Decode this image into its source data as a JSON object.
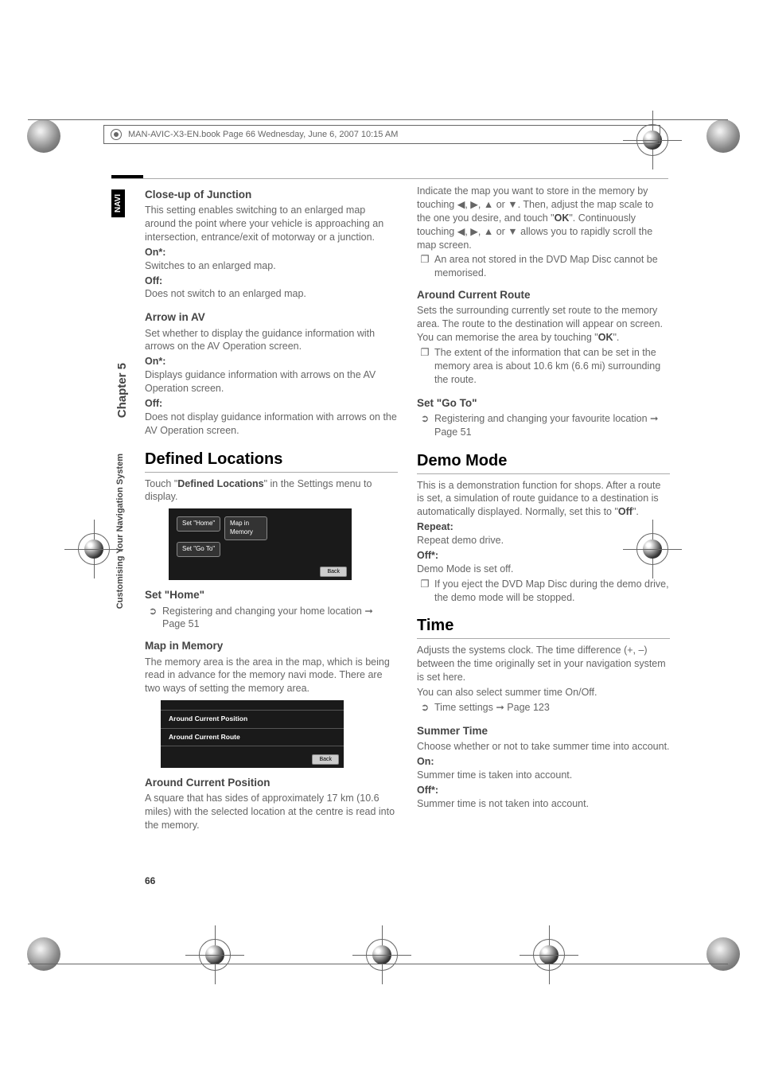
{
  "header": "MAN-AVIC-X3-EN.book  Page 66  Wednesday, June 6, 2007  10:15 AM",
  "page_number": "66",
  "side": {
    "navi": "NAVI",
    "chapter": "Chapter 5",
    "section": "Customising Your Navigation System"
  },
  "col1": {
    "closeup": {
      "title": "Close-up of Junction",
      "body": "This setting enables switching to an enlarged map around the point where your vehicle is approaching an intersection, entrance/exit of motorway or a junction.",
      "on_label": "On*:",
      "on_text": "Switches to an enlarged map.",
      "off_label": "Off:",
      "off_text": "Does not switch to an enlarged map."
    },
    "arrowav": {
      "title": "Arrow in AV",
      "body": "Set whether to display the guidance information with arrows on the AV Operation screen.",
      "on_label": "On*:",
      "on_text": "Displays guidance information with arrows on the AV Operation screen.",
      "off_label": "Off:",
      "off_text": "Does not display guidance information with arrows on the AV Operation screen."
    },
    "defloc": {
      "title": "Defined Locations",
      "intro_a": "Touch \"",
      "intro_b": "Defined Locations",
      "intro_c": "\" in the Settings menu to display."
    },
    "ss1": {
      "b1": "Set \"Home\"",
      "b2": "Map in Memory",
      "b3": "Set \"Go To\"",
      "back": "Back"
    },
    "sethome": {
      "title": "Set \"Home\"",
      "bullet": "Registering and changing your home location ➞ Page 51"
    },
    "mapmem": {
      "title": "Map in Memory",
      "body": "The memory area is the area in the map, which is being read in advance for the memory navi mode. There are two ways of setting the memory area."
    },
    "ss2": {
      "r1": "Around Current Position",
      "r2": "Around Current Route",
      "back": "Back"
    },
    "acp": {
      "title": "Around Current Position",
      "body": "A square that has sides of approximately 17 km (10.6 miles) with the selected location at the centre is read into the memory."
    }
  },
  "col2": {
    "indicate": {
      "a": "Indicate the map you want to store in the memory by touching ◀, ▶, ▲ or ▼. Then, adjust the map scale to the one you desire, and touch \"",
      "ok1": "OK",
      "b": "\". Continuously touching ◀, ▶, ▲ or ▼ allows you to rapidly scroll the map screen.",
      "note": "An area not stored in the DVD Map Disc cannot be memorised."
    },
    "acr": {
      "title": "Around Current Route",
      "body_a": "Sets the surrounding currently set route to the memory area. The route to the destination will appear on screen. You can memorise the area by touching \"",
      "ok": "OK",
      "body_b": "\".",
      "note": "The extent of the information that can be set in the memory area is about 10.6 km (6.6 mi) surrounding the route."
    },
    "goto": {
      "title": "Set \"Go To\"",
      "bullet": "Registering and changing your favourite location ➞ Page 51"
    },
    "demo": {
      "title": "Demo Mode",
      "body_a": "This is a demonstration function for shops. After a route is set, a simulation of route guidance to a destination is automatically displayed. Normally, set this to \"",
      "off": "Off",
      "body_b": "\".",
      "repeat_label": "Repeat:",
      "repeat_text": "Repeat demo drive.",
      "off_label": "Off*:",
      "off_text": "Demo Mode is set off.",
      "note": "If you eject the DVD Map Disc during the demo drive, the demo mode will be stopped."
    },
    "time": {
      "title": "Time",
      "body": "Adjusts the systems clock. The time difference (+, –) between the time originally set in your navigation system is set here.",
      "body2": "You can also select summer time On/Off.",
      "bullet": "Time settings ➞ Page 123"
    },
    "summer": {
      "title": "Summer Time",
      "body": "Choose whether or not to take summer time into account.",
      "on_label": "On:",
      "on_text": "Summer time is taken into account.",
      "off_label": "Off*:",
      "off_text": "Summer time is not taken into account."
    }
  }
}
